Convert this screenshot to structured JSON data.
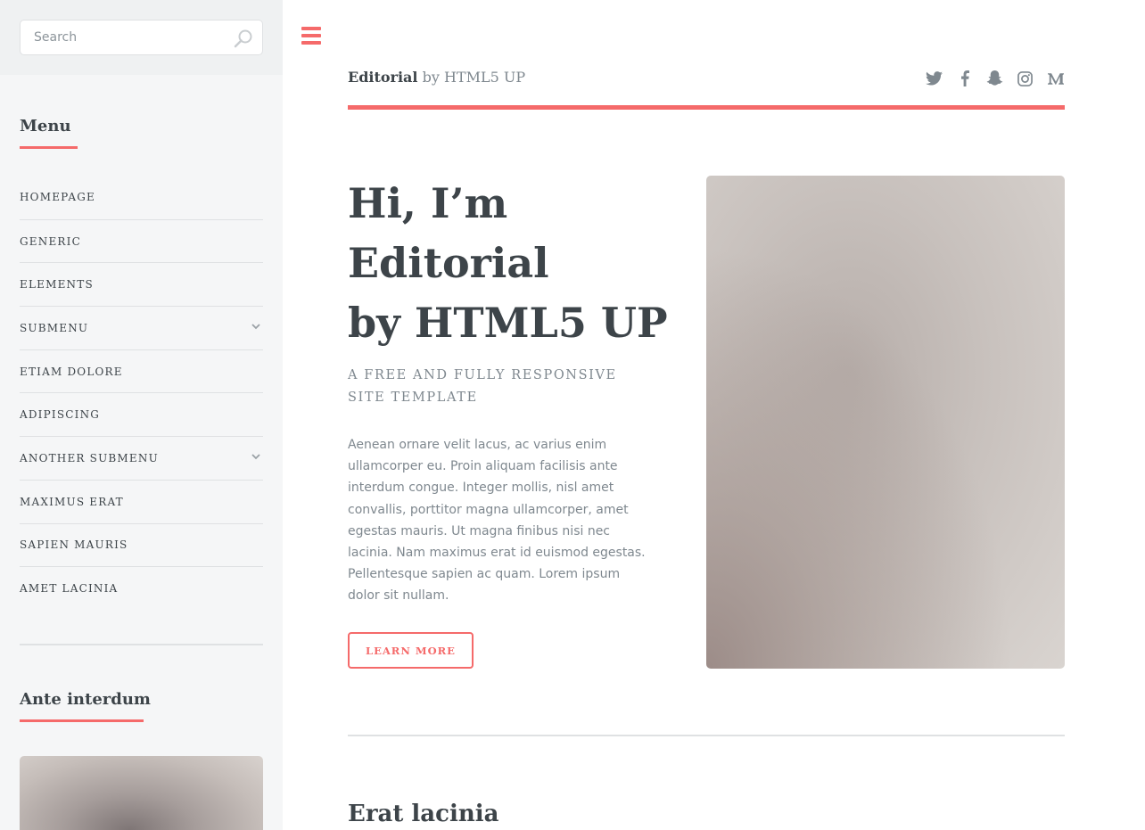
{
  "sidebar": {
    "search": {
      "placeholder": "Search"
    },
    "menu_title": "Menu",
    "items": [
      {
        "label": "Homepage",
        "has_submenu": false
      },
      {
        "label": "Generic",
        "has_submenu": false
      },
      {
        "label": "Elements",
        "has_submenu": false
      },
      {
        "label": "Submenu",
        "has_submenu": true
      },
      {
        "label": "Etiam Dolore",
        "has_submenu": false
      },
      {
        "label": "Adipiscing",
        "has_submenu": false
      },
      {
        "label": "Another Submenu",
        "has_submenu": true
      },
      {
        "label": "Maximus Erat",
        "has_submenu": false
      },
      {
        "label": "Sapien Mauris",
        "has_submenu": false
      },
      {
        "label": "Amet Lacinia",
        "has_submenu": false
      }
    ],
    "ante_title": "Ante interdum"
  },
  "header": {
    "brand_strong": "Editorial",
    "brand_rest": " by HTML5 UP",
    "socials": [
      "twitter-icon",
      "facebook-icon",
      "snapchat-icon",
      "instagram-icon",
      "medium-icon"
    ]
  },
  "hero": {
    "title_lines": [
      "Hi, I’m",
      "Editorial",
      "by HTML5 UP"
    ],
    "subtitle": "A free and fully responsive site template",
    "body": "Aenean ornare velit lacus, ac varius enim ullamcorper eu. Proin aliquam facilisis ante interdum congue. Integer mollis, nisl amet convallis, porttitor magna ullamcorper, amet egestas mauris. Ut magna finibus nisi nec lacinia. Nam maximus erat id euismod egestas. Pellentesque sapien ac quam. Lorem ipsum dolor sit nullam.",
    "button_label": "Learn More"
  },
  "section": {
    "title": "Erat lacinia"
  },
  "colors": {
    "accent": "#f56a6a",
    "heading": "#3d4449",
    "text": "#7f888f",
    "sidebar_bg": "#f5f6f7"
  }
}
